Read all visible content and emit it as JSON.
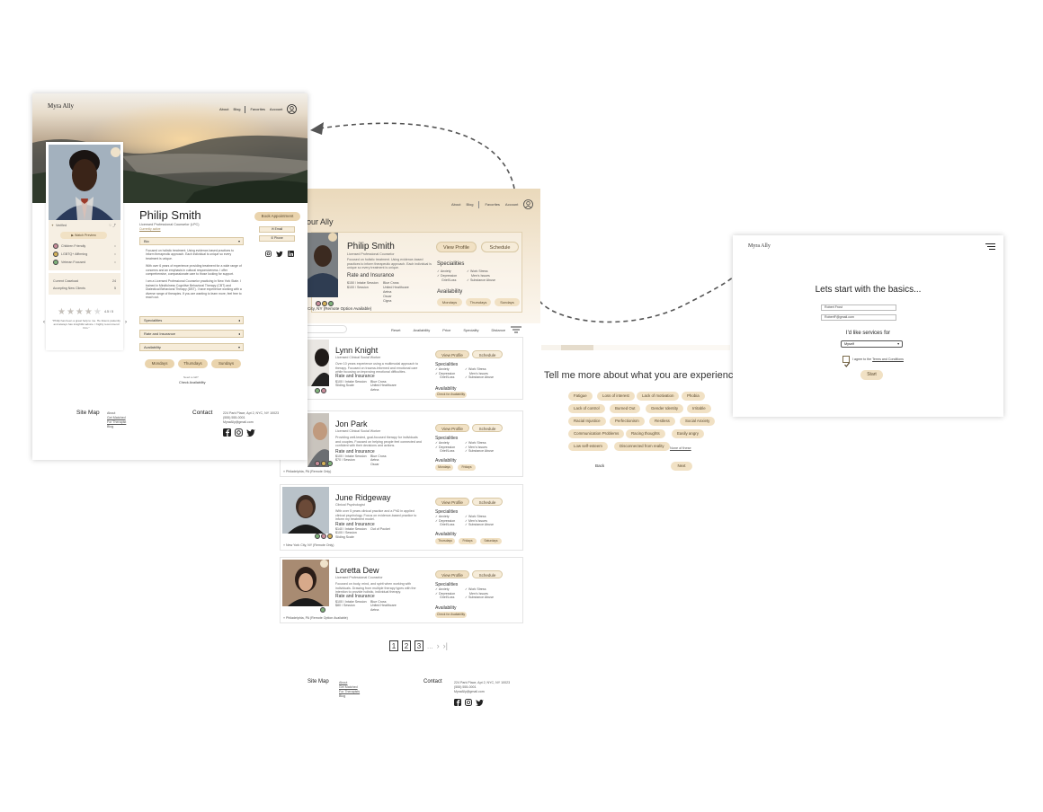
{
  "profile_page": {
    "brand": "Myra Ally",
    "nav": {
      "about": "About",
      "blog": "Blog",
      "favorites": "Favorites",
      "account": "Account"
    },
    "name": "Philip Smith",
    "role": "Licensed Professional Counselor (LPC)",
    "status": "Currently active",
    "verified": "Verified",
    "intro_button": "Watch Preview",
    "list_items": [
      "Children Friendly",
      "LGBTQ+ Affirming",
      "Veteran Focused"
    ],
    "current_caseload_label": "Current Caseload",
    "current_caseload_value": "24",
    "accepting_label": "Accepting New Clients",
    "accepting_value": "5",
    "rating": "4.5 / 5",
    "review_text": "\"Philip has been a great help to me. He listens patiently and always has insightful advice. I highly recommend him.\"",
    "bio_dropdown": "Bio",
    "bio_p1": "Focused on holistic treatment. Using evidence-based practices to inform therapeutic approach. Each individual is unique so every treatment is unique.",
    "bio_p2": "With over 6 years of experience providing treatment for a wide range of concerns and an emphasis in cultural responsiveness. I offer comprehensive, compassionate care to those looking for support.",
    "bio_p3": "I am a Licensed Professional Counselor practicing in New York State. I trained in Mindfulness Cognitive Behavioral Therapy (CBT) and Dialectical Behavioral Therapy (DBT). I have experience working with a diverse range of therapies. If you are wanting to learn more, feel free to reach out.",
    "sections": [
      "Specialities",
      "Rate and Insurance",
      "Availability"
    ],
    "days": [
      "Mondays",
      "Thursdays",
      "Sundays"
    ],
    "need_help": "Need a call?",
    "check_availability": "Check Availability",
    "book_button": "Book Appointment",
    "email_button": "Email",
    "phone_button": "Phone",
    "footer": {
      "sitemap": "Site Map",
      "links": [
        "About",
        "Get Matched",
        "For Therapist",
        "Blog"
      ],
      "contact": "Contact",
      "address": "224 Park Place, Apt 2, NYC, NY 10023",
      "phone": "(555) 555-0001",
      "email": "MyraAlly@gmail.com"
    }
  },
  "listing_page": {
    "nav": {
      "about": "About",
      "blog": "Blog",
      "favorites": "Favorites",
      "account": "Account"
    },
    "hero_title": "our Ally",
    "featured": {
      "name": "Philip Smith",
      "role": "Licensed Professional Counselor",
      "desc": "Focused on holistic treatment. Using evidence-based practices to inform therapeutic approach. Each individual is unique so every treatment is unique.",
      "rate_head": "Rate and Insurance",
      "rates": [
        "$150 / Intake Session",
        "$100 / Session"
      ],
      "insurance": [
        "Blue Cross",
        "United Healthcare",
        "Aetna",
        "Oscar",
        "Cigna"
      ],
      "location": "City, NY (Remote Option Available)",
      "view": "View Profile",
      "schedule": "Schedule",
      "spec_head": "Specialities",
      "specs1": [
        "Anxiety",
        "Depression",
        "Grief/Loss"
      ],
      "specs2": [
        "Work Stress",
        "Men's Issues",
        "Substance Abuse"
      ],
      "avail_head": "Availability",
      "days": [
        "Mondays",
        "Thursdays",
        "Sundays"
      ]
    },
    "filters": [
      "Reset",
      "Availability",
      "Price",
      "Speciality",
      "Distance"
    ],
    "cards": [
      {
        "name": "Lynn Knight",
        "role": "Licensed Clinical Social Worker",
        "desc": "Over 10 years experience using a multimodal approach to therapy. Focused on trauma-informed and emotional care while focusing on improving emotional difficulties.",
        "rates": [
          "$100 / Intake Session",
          "Sliding Scale"
        ],
        "insurance": [
          "Blue Cross",
          "United Healthcare",
          "Aetna"
        ],
        "specs1": [
          "Anxiety",
          "Depression",
          "Grief/Loss"
        ],
        "specs2": [
          "Work Stress",
          "Men's Issues",
          "Substance Abuse"
        ],
        "avail": [
          "Check for Availability"
        ],
        "location": ""
      },
      {
        "name": "Jon Park",
        "role": "Licensed Clinical Social Worker",
        "desc": "Providing well-tested, goal-focused therapy for individuals and couples. Focused on helping people feel connected and confident with their decisions and actions.",
        "rates": [
          "$100 / Intake Session",
          "$70 / Session"
        ],
        "insurance": [
          "Blue Cross",
          "Aetna",
          "Oscar"
        ],
        "specs1": [
          "Anxiety",
          "Depression",
          "Grief/Loss"
        ],
        "specs2": [
          "Work Stress",
          "Men's Issues",
          "Substance Abuse"
        ],
        "avail": [
          "Mondays",
          "Fridays"
        ],
        "location": "Philadelphia, PA (Remote Only)"
      },
      {
        "name": "June Ridgeway",
        "role": "Clinical Psychologist",
        "desc": "With over 5 years clinical practice and a PhD in applied clinical psychology. Focus on evidence-based practice to inform my treatment model.",
        "rates": [
          "$140 / Intake Session",
          "$100 / Session",
          "Sliding Scale"
        ],
        "insurance": [
          "Out of Pocket"
        ],
        "specs1": [
          "Anxiety",
          "Depression",
          "Grief/Loss"
        ],
        "specs2": [
          "Work Stress",
          "Men's Issues",
          "Substance Abuse"
        ],
        "avail": [
          "Thursdays",
          "Fridays",
          "Saturdays"
        ],
        "location": "New York City, NY (Remote Only)"
      },
      {
        "name": "Loretta Dew",
        "role": "Licensed Professional Counselor",
        "desc": "Focused on body, mind, and spirit when working with individuals. Drawing from multiple therapy types with the intention to provide holistic, individual therapy.",
        "rates": [
          "$100 / Intake Session",
          "$80 / Session"
        ],
        "insurance": [
          "Blue Cross",
          "United Healthcare",
          "Aetna"
        ],
        "specs1": [
          "Anxiety",
          "Depression",
          "Grief/Loss"
        ],
        "specs2": [
          "Work Stress",
          "Men's Issues",
          "Substance Abuse"
        ],
        "avail": [
          "Check for Availability"
        ],
        "location": "Philadelphia, PA (Remote Option Available)"
      }
    ],
    "pages": [
      "1",
      "2",
      "3"
    ],
    "ellipsis": "...",
    "footer": {
      "sitemap": "Site Map",
      "links": [
        "About",
        "Get Matched",
        "For Therapists",
        "Blog"
      ],
      "contact": "Contact",
      "address": "224 Park Place, Apt 2, NYC, NY 10023",
      "phone": "(555) 555-0001",
      "email": "MyraAlly@gmail.com"
    }
  },
  "questionnaire": {
    "title": "Tell me more about what you are experiencing.",
    "chips": [
      "Fatigue",
      "Loss of interest",
      "Lack of motivation",
      "Phobia",
      "Lack of control",
      "Burned Out",
      "Gender Identity",
      "Irritable",
      "Racial Injustice",
      "Perfectionism",
      "Restless",
      "Social Anxiety",
      "Communication Problems",
      "Racing thoughts",
      "Easily angry",
      "Low self-esteem",
      "Disconnected from reality"
    ],
    "none": "None of these",
    "back": "Back",
    "next": "Next"
  },
  "signup": {
    "brand": "Myra Ally",
    "title": "Lets start with the basics...",
    "name_value": "Robert Frost",
    "email_value": "RobertF@gmail.com",
    "services_label": "I'd like services for",
    "services_value": "Myself",
    "terms_prefix": "I agree to the ",
    "terms_link": "Terms and Conditions",
    "start": "Start"
  },
  "colors": {
    "accent": "#f1e1c4",
    "accent_dark": "#d8c7a3",
    "text": "#333333"
  }
}
